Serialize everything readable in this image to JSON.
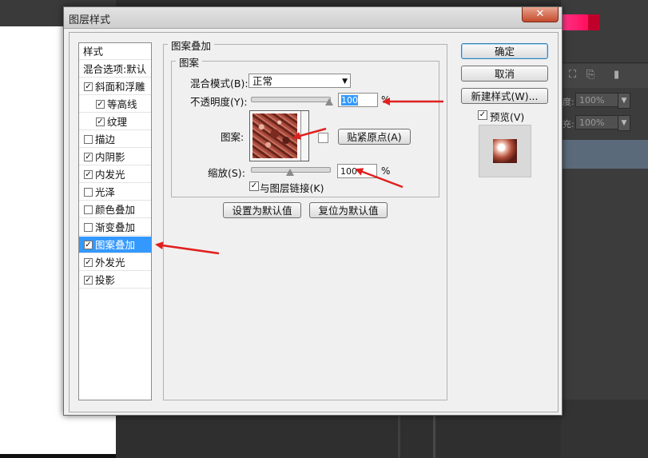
{
  "window": {
    "title": "图层样式",
    "close_glyph": "✕"
  },
  "style_list": {
    "header": "样式",
    "items": [
      {
        "label": "混合选项:默认",
        "checkable": false,
        "checked": false,
        "selected": false
      },
      {
        "label": "斜面和浮雕",
        "checkable": true,
        "checked": true,
        "selected": false
      },
      {
        "label": "等高线",
        "checkable": true,
        "checked": true,
        "selected": false,
        "indent": true
      },
      {
        "label": "纹理",
        "checkable": true,
        "checked": true,
        "selected": false,
        "indent": true
      },
      {
        "label": "描边",
        "checkable": true,
        "checked": false,
        "selected": false
      },
      {
        "label": "内阴影",
        "checkable": true,
        "checked": true,
        "selected": false
      },
      {
        "label": "内发光",
        "checkable": true,
        "checked": true,
        "selected": false
      },
      {
        "label": "光泽",
        "checkable": true,
        "checked": false,
        "selected": false
      },
      {
        "label": "颜色叠加",
        "checkable": true,
        "checked": false,
        "selected": false
      },
      {
        "label": "渐变叠加",
        "checkable": true,
        "checked": false,
        "selected": false
      },
      {
        "label": "图案叠加",
        "checkable": true,
        "checked": true,
        "selected": true
      },
      {
        "label": "外发光",
        "checkable": true,
        "checked": true,
        "selected": false
      },
      {
        "label": "投影",
        "checkable": true,
        "checked": true,
        "selected": false
      }
    ]
  },
  "pattern_overlay": {
    "group_title": "图案叠加",
    "sub_title": "图案",
    "blend_mode_label": "混合模式(B):",
    "blend_mode_value": "正常",
    "opacity_label": "不透明度(Y):",
    "opacity_value": "100",
    "opacity_level_pct": 100,
    "percent_sign": "%",
    "pattern_label": "图案:",
    "snap_origin_button": "贴紧原点(A)",
    "scale_label": "缩放(S):",
    "scale_value": "100",
    "scale_level_pct": 50,
    "link_label": "与图层链接(K)",
    "link_checked": true,
    "set_default_button": "设置为默认值",
    "reset_default_button": "复位为默认值"
  },
  "right_panel": {
    "ok_button": "确定",
    "cancel_button": "取消",
    "new_style_button": "新建样式(W)...",
    "preview_label": "预览(V)",
    "preview_checked": true
  },
  "background_app": {
    "opacity_label_1": "度:",
    "opacity_value_1": "100%",
    "fill_label_1": "充:",
    "fill_value_1": "100%"
  },
  "colors": {
    "selection": "#3399ff",
    "annotation_arrow": "#e0201e",
    "close_button": "#c44a2c"
  },
  "icons": {
    "check": "✓",
    "dropdown": "▼"
  }
}
